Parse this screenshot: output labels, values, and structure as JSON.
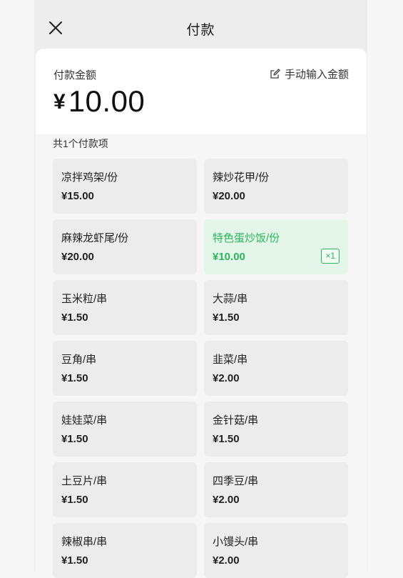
{
  "header": {
    "title": "付款"
  },
  "amount": {
    "label": "付款金额",
    "currency": "¥",
    "value": "10.00",
    "manual_input_label": "手动输入金额"
  },
  "list": {
    "count_label": "共1个付款项",
    "items": [
      {
        "name": "凉拌鸡架/份",
        "price": "¥15.00"
      },
      {
        "name": "辣炒花甲/份",
        "price": "¥20.00"
      },
      {
        "name": "麻辣龙虾尾/份",
        "price": "¥20.00"
      },
      {
        "name": "特色蛋炒饭/份",
        "price": "¥10.00",
        "selected": true,
        "qty": "×1"
      },
      {
        "name": "玉米粒/串",
        "price": "¥1.50"
      },
      {
        "name": "大蒜/串",
        "price": "¥1.50"
      },
      {
        "name": "豆角/串",
        "price": "¥1.50"
      },
      {
        "name": "韭菜/串",
        "price": "¥2.00"
      },
      {
        "name": "娃娃菜/串",
        "price": "¥1.50"
      },
      {
        "name": "金针菇/串",
        "price": "¥1.50"
      },
      {
        "name": "土豆片/串",
        "price": "¥1.50"
      },
      {
        "name": "四季豆/串",
        "price": "¥2.00"
      },
      {
        "name": "辣椒串/串",
        "price": "¥1.50"
      },
      {
        "name": "小馒头/串",
        "price": "¥2.00"
      }
    ]
  },
  "colors": {
    "accent": "#2bb45a",
    "selected_bg": "#e4f6ea"
  },
  "icons": {
    "close": "close-icon",
    "edit": "edit-icon"
  }
}
